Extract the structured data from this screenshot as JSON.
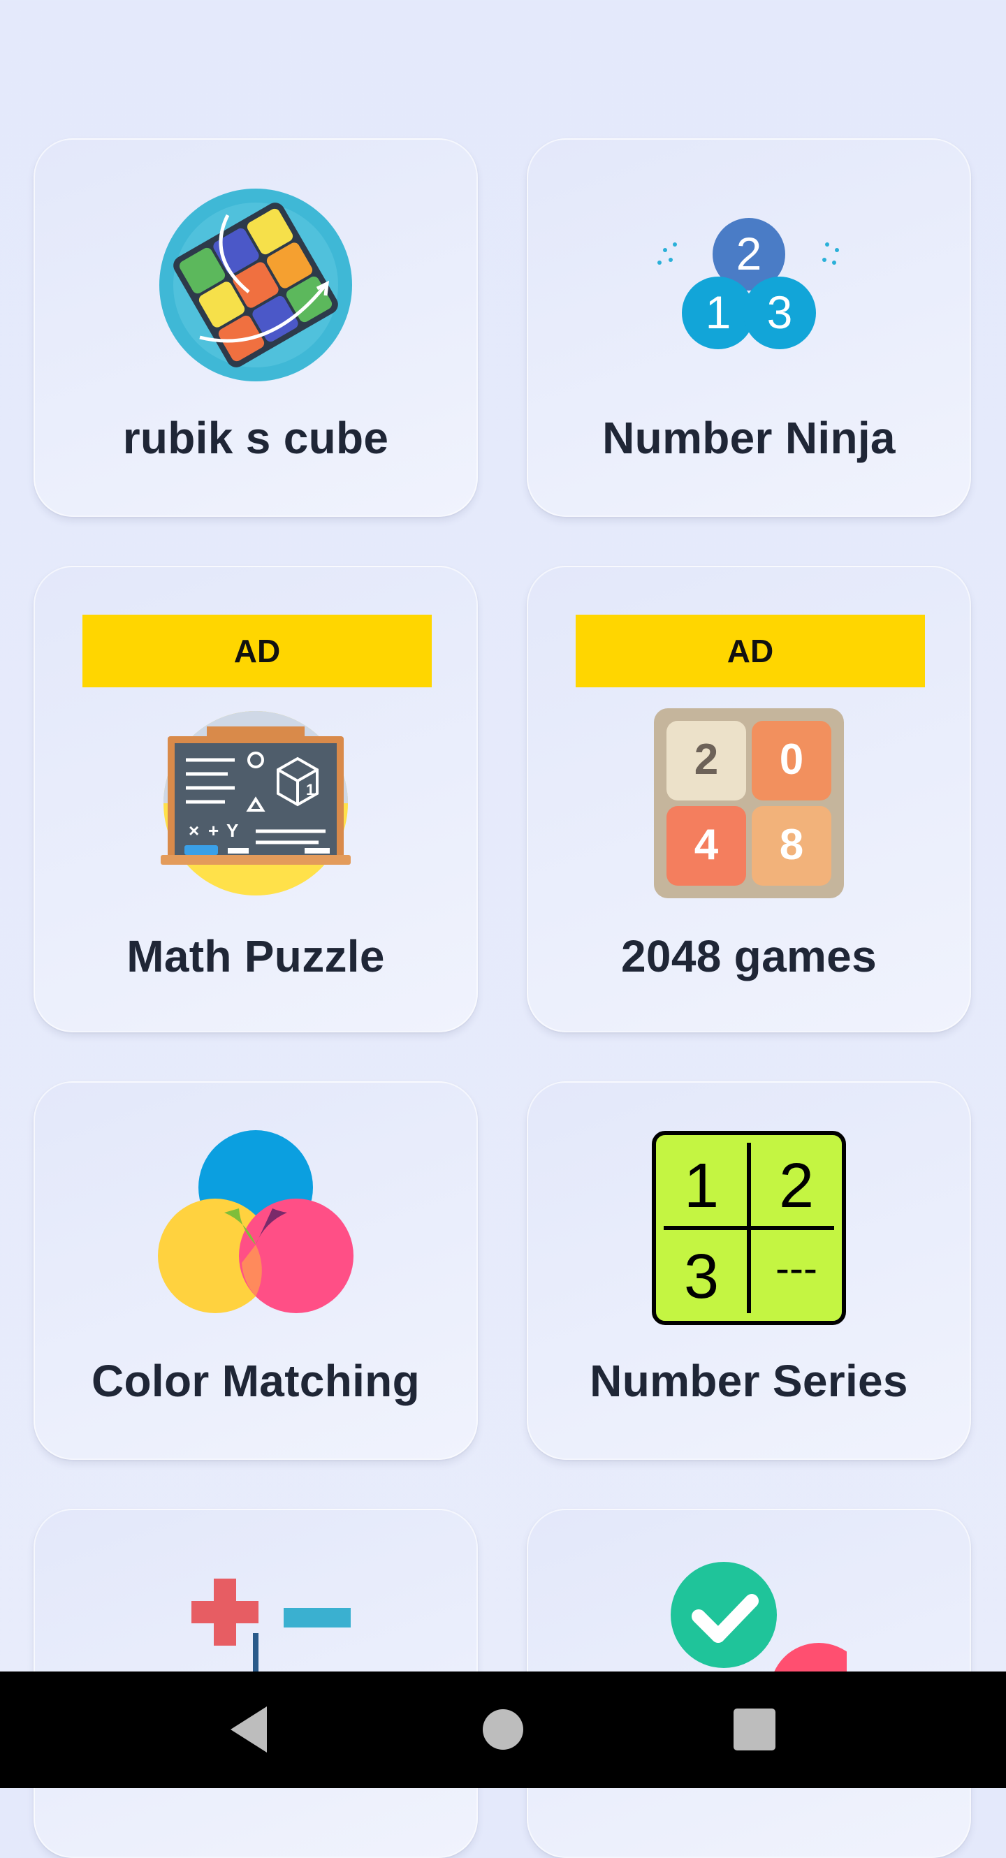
{
  "games": [
    {
      "title": "rubik s cube",
      "icon": "rubiks-cube-icon",
      "ad": null
    },
    {
      "title": "Number Ninja",
      "icon": "number-ninja-icon",
      "ad": null
    },
    {
      "title": "Math Puzzle",
      "icon": "chalkboard-icon",
      "ad": "AD"
    },
    {
      "title": "2048 games",
      "icon": "2048-tiles-icon",
      "ad": "AD",
      "tiles": [
        "2",
        "0",
        "4",
        "8"
      ]
    },
    {
      "title": "Color Matching",
      "icon": "color-circles-icon",
      "ad": null
    },
    {
      "title": "Number Series",
      "icon": "number-grid-icon",
      "ad": null,
      "grid": [
        "1",
        "2",
        "3",
        "---"
      ]
    },
    {
      "title": "",
      "icon": "math-operators-icon",
      "ad": null
    },
    {
      "title": "",
      "icon": "checkmark-icon",
      "ad": null
    }
  ],
  "ninja_numbers": [
    "2",
    "1",
    "3"
  ],
  "chalkboard_text": [
    "1",
    "×",
    "+",
    "Y"
  ],
  "colors": {
    "ad_banner": "#ffd600",
    "title": "#1f2636",
    "navbar": "#000000"
  },
  "navbar": {
    "icons": [
      "back-icon",
      "home-icon",
      "recents-icon"
    ]
  }
}
